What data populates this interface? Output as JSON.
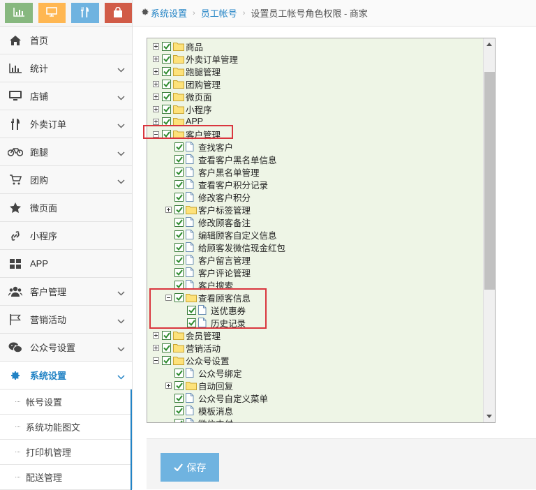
{
  "sidebar": {
    "shortcuts": [
      {
        "icon": "bar-chart-icon",
        "color": "#87b87f"
      },
      {
        "icon": "monitor-icon",
        "color": "#ffb752"
      },
      {
        "icon": "cutlery-icon",
        "color": "#6fb3e0"
      },
      {
        "icon": "shopping-bag-icon",
        "color": "#d15b47"
      }
    ],
    "items": [
      {
        "label": "首页",
        "icon": "home-icon",
        "chevron": false
      },
      {
        "label": "统计",
        "icon": "bar-chart-icon",
        "chevron": true
      },
      {
        "label": "店铺",
        "icon": "desktop-icon",
        "chevron": true
      },
      {
        "label": "外卖订单",
        "icon": "cutlery-icon",
        "chevron": true
      },
      {
        "label": "跑腿",
        "icon": "bicycle-icon",
        "chevron": true
      },
      {
        "label": "团购",
        "icon": "cart-icon",
        "chevron": true
      },
      {
        "label": "微页面",
        "icon": "star-icon",
        "chevron": false
      },
      {
        "label": "小程序",
        "icon": "link-icon",
        "chevron": false
      },
      {
        "label": "APP",
        "icon": "grid-icon",
        "chevron": false
      },
      {
        "label": "客户管理",
        "icon": "users-icon",
        "chevron": true
      },
      {
        "label": "营销活动",
        "icon": "flag-icon",
        "chevron": true
      },
      {
        "label": "公众号设置",
        "icon": "wechat-icon",
        "chevron": true
      },
      {
        "label": "系统设置",
        "icon": "gear-icon",
        "chevron": true,
        "active": true
      }
    ],
    "subitems": [
      "帐号设置",
      "系统功能图文",
      "打印机管理",
      "配送管理"
    ],
    "accent_color": "#2283c5"
  },
  "breadcrumb": {
    "items": [
      "系统设置",
      "员工帐号"
    ],
    "current": "设置员工帐号角色权限 - 商家"
  },
  "tree": {
    "nodes": [
      {
        "label": "商品",
        "level": 0,
        "folder": true,
        "expander": "plus"
      },
      {
        "label": "外卖订单管理",
        "level": 0,
        "folder": true,
        "expander": "plus"
      },
      {
        "label": "跑腿管理",
        "level": 0,
        "folder": true,
        "expander": "plus"
      },
      {
        "label": "团购管理",
        "level": 0,
        "folder": true,
        "expander": "plus"
      },
      {
        "label": "微页面",
        "level": 0,
        "folder": true,
        "expander": "plus"
      },
      {
        "label": "小程序",
        "level": 0,
        "folder": true,
        "expander": "plus"
      },
      {
        "label": "APP",
        "level": 0,
        "folder": true,
        "expander": "plus"
      },
      {
        "label": "客户管理",
        "level": 0,
        "folder": true,
        "expander": "minus",
        "open": true
      },
      {
        "label": "查找客户",
        "level": 1,
        "folder": false
      },
      {
        "label": "查看客户黑名单信息",
        "level": 1,
        "folder": false
      },
      {
        "label": "客户黑名单管理",
        "level": 1,
        "folder": false
      },
      {
        "label": "查看客户积分记录",
        "level": 1,
        "folder": false
      },
      {
        "label": "修改客户积分",
        "level": 1,
        "folder": false
      },
      {
        "label": "客户标签管理",
        "level": 1,
        "folder": true,
        "expander": "plus"
      },
      {
        "label": "修改顾客备注",
        "level": 1,
        "folder": false
      },
      {
        "label": "编辑顾客自定义信息",
        "level": 1,
        "folder": false
      },
      {
        "label": "给顾客发微信现金红包",
        "level": 1,
        "folder": false
      },
      {
        "label": "客户留言管理",
        "level": 1,
        "folder": false
      },
      {
        "label": "客户评论管理",
        "level": 1,
        "folder": false
      },
      {
        "label": "客户搜索",
        "level": 1,
        "folder": false
      },
      {
        "label": "查看顾客信息",
        "level": 1,
        "folder": true,
        "expander": "minus",
        "open": true
      },
      {
        "label": "送优惠券",
        "level": 2,
        "folder": false
      },
      {
        "label": "历史记录",
        "level": 2,
        "folder": false
      },
      {
        "label": "会员管理",
        "level": 0,
        "folder": true,
        "expander": "plus"
      },
      {
        "label": "营销活动",
        "level": 0,
        "folder": true,
        "expander": "plus"
      },
      {
        "label": "公众号设置",
        "level": 0,
        "folder": true,
        "expander": "minus",
        "open": true
      },
      {
        "label": "公众号绑定",
        "level": 1,
        "folder": false
      },
      {
        "label": "自动回复",
        "level": 1,
        "folder": true,
        "expander": "plus"
      },
      {
        "label": "公众号自定义菜单",
        "level": 1,
        "folder": false
      },
      {
        "label": "模板消息",
        "level": 1,
        "folder": false
      },
      {
        "label": "微信支付",
        "level": 1,
        "folder": false
      }
    ],
    "checked_color": "#2e8b2e",
    "highlight_color": "#d9363e"
  },
  "footer": {
    "save_label": "保存",
    "save_icon": "check-icon",
    "save_color": "#6fb3e0"
  }
}
